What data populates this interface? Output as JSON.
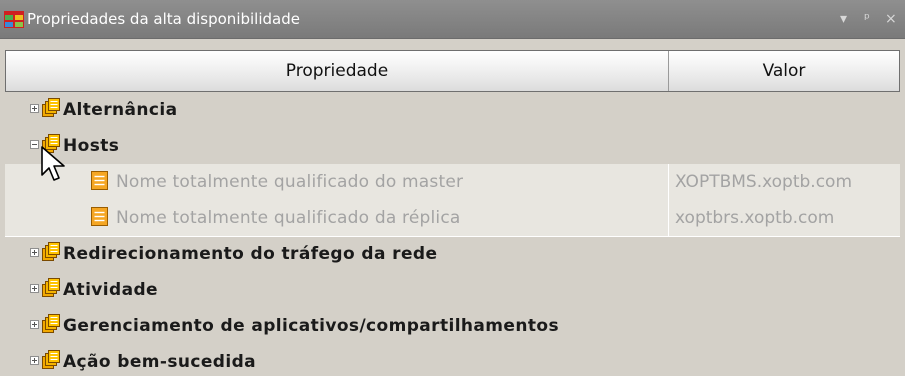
{
  "window": {
    "title": "Propriedades da alta disponibilidade",
    "controls": {
      "dropdown": "▾",
      "pin": "ᵖ",
      "close": "×"
    }
  },
  "table": {
    "headers": {
      "property": "Propriedade",
      "value": "Valor"
    },
    "rows": [
      {
        "label": "Alternância",
        "expander": "collapsed"
      },
      {
        "label": "Hosts",
        "expander": "expanded"
      },
      {
        "label": "Nome totalmente qualificado do master",
        "value": "XOPTBMS.xoptb.com",
        "sub": true
      },
      {
        "label": "Nome totalmente qualificado da réplica",
        "value": "xoptbrs.xoptb.com",
        "sub": true
      },
      {
        "label": "Redirecionamento do tráfego da rede",
        "expander": "collapsed"
      },
      {
        "label": "Atividade",
        "expander": "collapsed"
      },
      {
        "label": "Gerenciamento de aplicativos/compartilhamentos",
        "expander": "collapsed"
      },
      {
        "label": "Ação bem-sucedida",
        "expander": "collapsed"
      }
    ]
  },
  "icons": {
    "window": "grid-app-icon",
    "category": "stacked-documents-icon",
    "property": "document-icon",
    "cursor": "mouse-pointer-icon"
  },
  "colors": {
    "titlebar": "#7f7f7f",
    "panel": "#d4d0c8",
    "category_icon": "#f2a900",
    "disabled_text": "#a3a3a3"
  }
}
